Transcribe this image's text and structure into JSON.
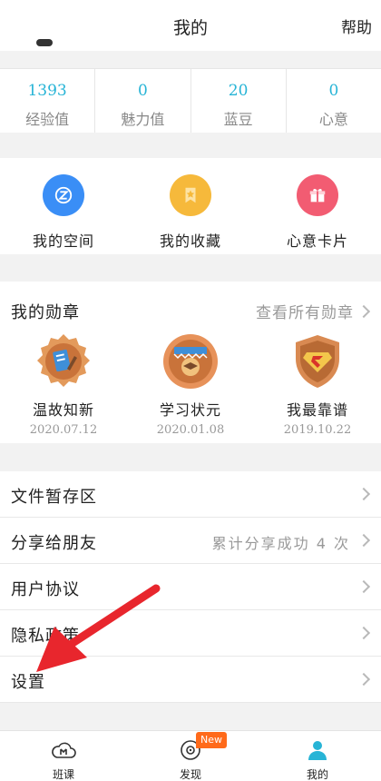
{
  "header": {
    "title": "我的",
    "help_label": "帮助"
  },
  "stats": [
    {
      "value": "1393",
      "label": "经验值"
    },
    {
      "value": "0",
      "label": "魅力值"
    },
    {
      "value": "20",
      "label": "蓝豆"
    },
    {
      "value": "0",
      "label": "心意"
    }
  ],
  "quick": [
    {
      "label": "我的空间",
      "icon": "space-icon",
      "color": "#3a8ef6"
    },
    {
      "label": "我的收藏",
      "icon": "favorites-star-icon",
      "color": "#f6b93b"
    },
    {
      "label": "心意卡片",
      "icon": "gift-icon",
      "color": "#f25c72"
    }
  ],
  "badges": {
    "title": "我的勋章",
    "more_label": "查看所有勋章",
    "items": [
      {
        "name": "温故知新",
        "date": "2020.07.12",
        "icon": "book-medal-icon"
      },
      {
        "name": "学习状元",
        "date": "2020.01.08",
        "icon": "graduation-medal-icon"
      },
      {
        "name": "我最靠谱",
        "date": "2019.10.22",
        "icon": "superman-shield-icon"
      }
    ]
  },
  "menu": [
    {
      "label": "文件暂存区",
      "value": ""
    },
    {
      "label": "分享给朋友",
      "value": "累计分享成功 4 次"
    },
    {
      "label": "用户协议",
      "value": ""
    },
    {
      "label": "隐私政策",
      "value": ""
    },
    {
      "label": "设置",
      "value": ""
    }
  ],
  "tabbar": [
    {
      "label": "班课",
      "icon": "class-cloud-icon"
    },
    {
      "label": "发现",
      "icon": "discover-icon"
    },
    {
      "label": "我的",
      "icon": "profile-icon"
    }
  ],
  "new_badge": "New",
  "colors": {
    "accent": "#27b4d6",
    "annotation_arrow": "#e8262d",
    "new_badge": "#ff6a1a"
  }
}
